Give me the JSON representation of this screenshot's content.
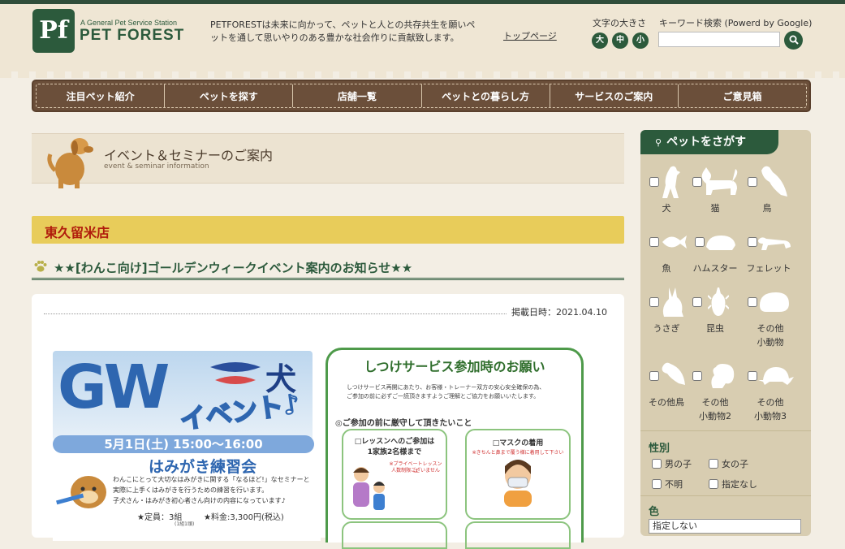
{
  "header": {
    "logo_mark": "Pf",
    "logo_sub": "A General Pet Service Station",
    "logo_name": "PET FOREST",
    "tagline": "PETFORESTは未来に向かって、ペットと人との共存共生を願いペットを通して思いやりのある豊かな社会作りに貢献致します。",
    "top_link": "トップページ",
    "font_size_label": "文字の大きさ",
    "font_size_large": "大",
    "font_size_medium": "中",
    "font_size_small": "小",
    "search_label": "キーワード検索 (Powerd by Google)",
    "search_placeholder": ""
  },
  "nav": {
    "items": [
      "注目ペット紹介",
      "ペットを探す",
      "店舗一覧",
      "ペットとの暮らし方",
      "サービスのご案内",
      "ご意見箱"
    ]
  },
  "banner": {
    "title": "イベント＆セミナーのご案内",
    "subtitle": "event & seminar information"
  },
  "store_name": "東久留米店",
  "post": {
    "title": "★★[わんこ向け]ゴールデンウィークイベント案内のお知らせ★★",
    "date": "掲載日時：2021.04.10"
  },
  "flyer_left": {
    "big1": "GW",
    "big2": "犬",
    "big3": "イベント♪",
    "date_line": "5月1日(土) 15:00〜16:00",
    "event_name": "はみがき練習会",
    "desc1": "わんこにとって大切なはみがきに関する「なるほど!」なセミナーと",
    "desc2": "実際に上手くはみがきを行うための練習を行います。",
    "desc3": "子犬さん・はみがき初心者さん向けの内容になっています♪",
    "capacity": "★定員：3組",
    "capacity_note": "(1組1頭)",
    "fee": "★料金:3,300円(税込)"
  },
  "flyer_right": {
    "title": "しつけサービス参加時のお願い",
    "intro1": "しつけサービス再開にあたり、お客様・トレーナー双方の安心安全確保の為、",
    "intro2": "ご参加の前に必ずご一読頂きますようご理解とご協力をお願いいたします。",
    "section": "◎ご参加の前に厳守して頂きたいこと",
    "box1_title": "□レッスンへのご参加は",
    "box1_title2": "1家族2名様まで",
    "box1_note": "※プライベートレッスンは",
    "box1_note2": "人数制限ございません",
    "box2_title": "□マスクの着用",
    "box2_note": "※きちんと鼻まで覆う様に着用して下さい"
  },
  "sidebar": {
    "title": "ペットをさがす",
    "pets": [
      {
        "label": "犬",
        "label2": "",
        "icon": "dog-icon"
      },
      {
        "label": "猫",
        "label2": "",
        "icon": "cat-icon"
      },
      {
        "label": "鳥",
        "label2": "",
        "icon": "bird-icon"
      },
      {
        "label": "魚",
        "label2": "",
        "icon": "fish-icon"
      },
      {
        "label": "ハムスター",
        "label2": "",
        "icon": "hamster-icon"
      },
      {
        "label": "フェレット",
        "label2": "",
        "icon": "ferret-icon"
      },
      {
        "label": "うさぎ",
        "label2": "",
        "icon": "rabbit-icon"
      },
      {
        "label": "昆虫",
        "label2": "",
        "icon": "insect-icon"
      },
      {
        "label": "その他",
        "label2": "小動物",
        "icon": "small-animal-icon"
      },
      {
        "label": "その他鳥",
        "label2": "",
        "icon": "other-bird-icon"
      },
      {
        "label": "その他",
        "label2": "小動物2",
        "icon": "squirrel-icon"
      },
      {
        "label": "その他",
        "label2": "小動物3",
        "icon": "turtle-icon"
      }
    ],
    "gender_heading": "性別",
    "gender_options": [
      "男の子",
      "女の子",
      "不明",
      "指定なし"
    ],
    "color_heading": "色",
    "color_select": "指定しない"
  },
  "colors": {
    "brand_green": "#2c5a3c",
    "nav_brown": "#6b4f3a",
    "store_bar": "#e8cc5a",
    "store_text": "#b01c0c",
    "sidebar_bg": "#d8cdb1"
  }
}
